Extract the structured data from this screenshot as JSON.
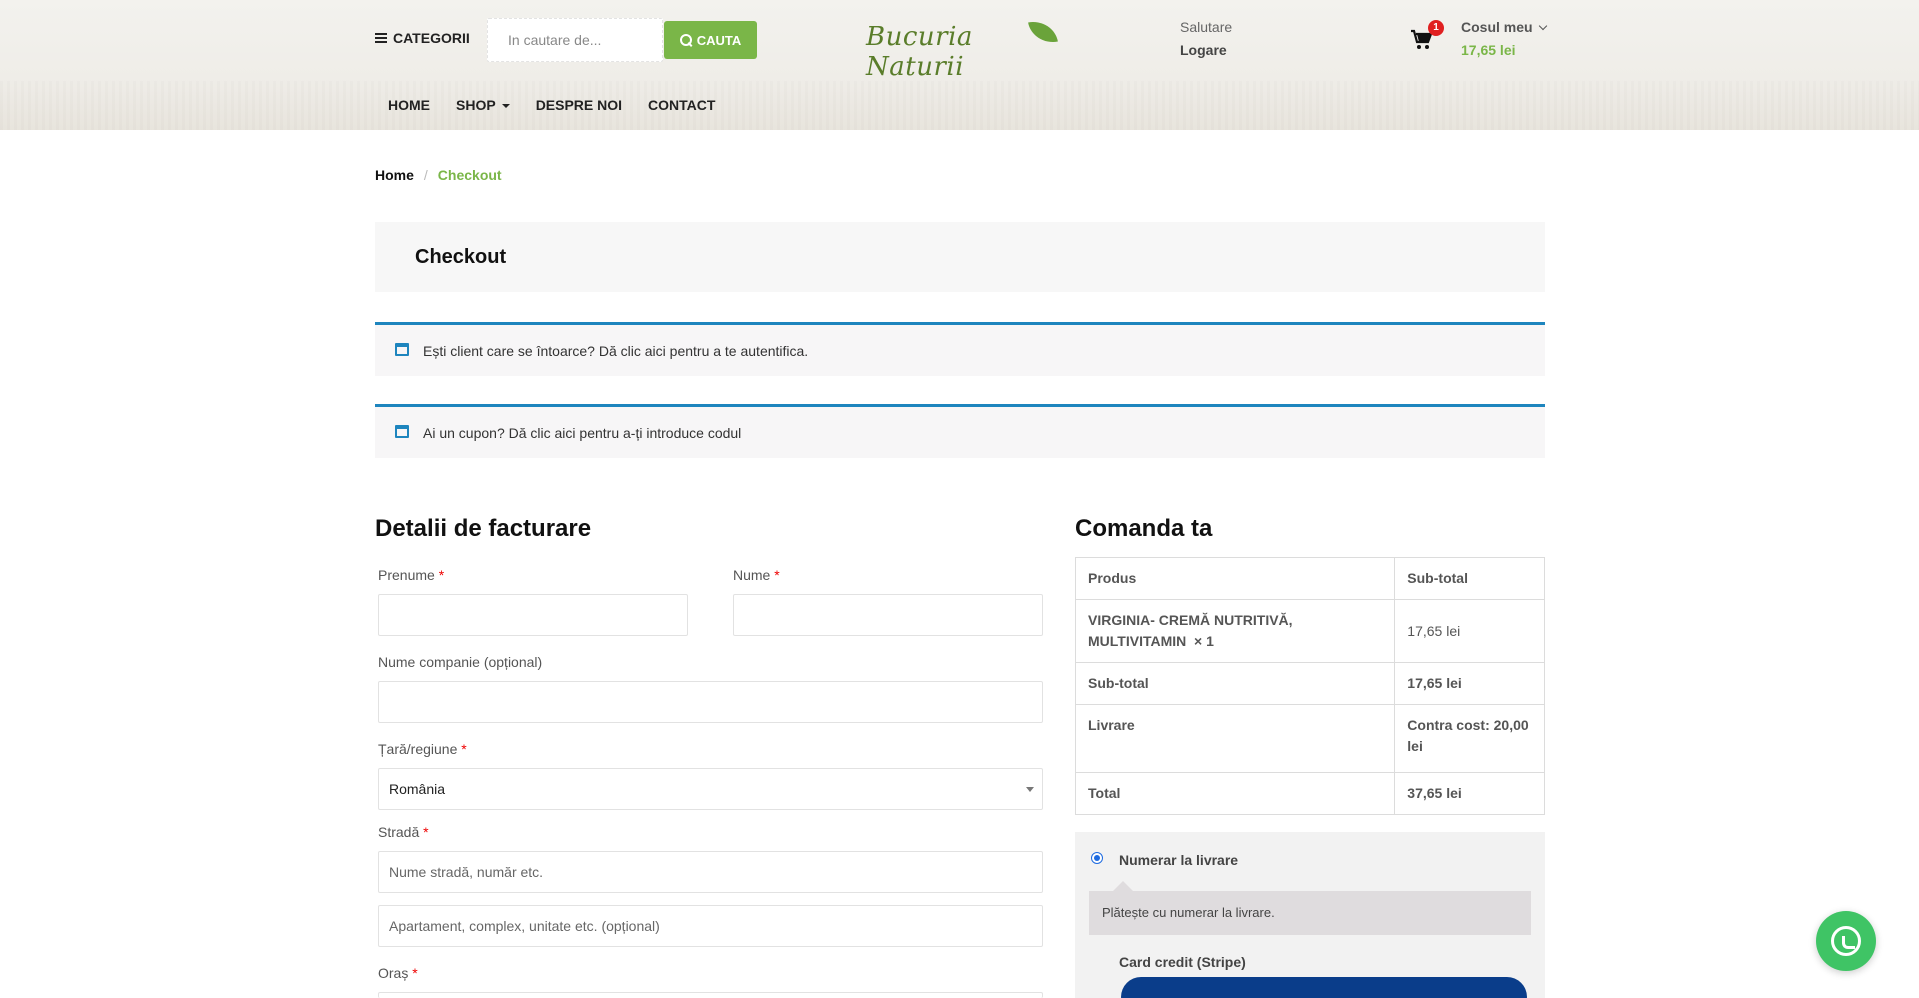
{
  "header": {
    "categories_label": "CATEGORII",
    "search_placeholder": "In cautare de...",
    "search_button": "CAUTA",
    "logo_text": "Bucuria Naturii",
    "greeting": "Salutare",
    "login": "Logare",
    "cart_count": "1",
    "cart_label": "Cosul meu",
    "cart_amount": "17,65 lei"
  },
  "nav": {
    "items": [
      "HOME",
      "SHOP",
      "DESPRE NOI",
      "CONTACT"
    ]
  },
  "breadcrumb": {
    "home": "Home",
    "sep": "/",
    "current": "Checkout"
  },
  "page_title": "Checkout",
  "notices": [
    "Ești client care se întoarce? Dă clic aici pentru a te autentifica.",
    "Ai un cupon? Dă clic aici pentru a-ți introduce codul"
  ],
  "billing": {
    "title": "Detalii de facturare",
    "first_name_label": "Prenume",
    "last_name_label": "Nume",
    "company_label": "Nume companie (opțional)",
    "country_label": "Țară/regiune",
    "country_value": "România",
    "street_label": "Stradă",
    "street_placeholder": "Nume stradă, număr etc.",
    "apartment_placeholder": "Apartament, complex, unitate etc. (opțional)",
    "city_label": "Oraș",
    "required_mark": "*"
  },
  "order": {
    "title": "Comanda ta",
    "col_product": "Produs",
    "col_subtotal": "Sub-total",
    "product_name": "VIRGINIA- CREMĂ NUTRITIVĂ, MULTIVITAMIN",
    "product_qty": "× 1",
    "product_price": "17,65 lei",
    "subtotal_label": "Sub-total",
    "subtotal_value": "17,65 lei",
    "shipping_label": "Livrare",
    "shipping_value": "Contra cost: 20,00 lei",
    "total_label": "Total",
    "total_value": "37,65 lei"
  },
  "payment": {
    "cod_label": "Numerar la livrare",
    "cod_description": "Plătește cu numerar la livrare.",
    "card_label": "Card credit (Stripe)"
  },
  "colors": {
    "accent_green": "#7ab648",
    "notice_blue": "#1e85be",
    "stripe_blue": "#0a3d8a",
    "whatsapp_green": "#3fc465"
  }
}
